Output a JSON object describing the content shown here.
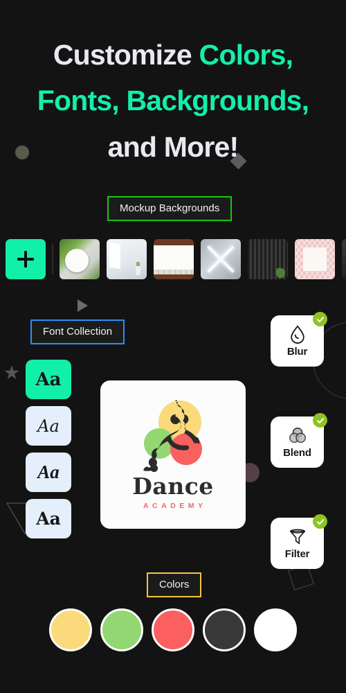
{
  "headline": {
    "line1_a": "Customize ",
    "line1_b": "Colors,",
    "line2": "Fonts, Backgrounds,",
    "line3_a": "and ",
    "line3_b": "More!"
  },
  "chips": {
    "mockup_backgrounds": "Mockup Backgrounds",
    "font_collection": "Font Collection",
    "colors": "Colors"
  },
  "thumbnails": {
    "add_label": "+",
    "items": [
      {
        "name": "plate-leaves-thumbnail",
        "style": "tb-plate"
      },
      {
        "name": "white-room-thumbnail",
        "style": "tb-room"
      },
      {
        "name": "wood-frame-thumbnail",
        "style": "tb-frame"
      },
      {
        "name": "light-panel-thumbnail",
        "style": "tb-lights"
      },
      {
        "name": "dark-slats-thumbnail",
        "style": "tb-slats"
      },
      {
        "name": "pink-palm-thumbnail",
        "style": "tb-palm"
      },
      {
        "name": "dark-wall-thumbnail",
        "style": "tb-dark"
      }
    ]
  },
  "font_cards": [
    {
      "label": "Aa",
      "style": "fc-slab",
      "selected": true
    },
    {
      "label": "Aa",
      "style": "fc-script",
      "selected": false
    },
    {
      "label": "Aa",
      "style": "fc-italic",
      "selected": false
    },
    {
      "label": "Aa",
      "style": "fc-bold",
      "selected": false
    }
  ],
  "features": [
    {
      "label": "Blur",
      "icon": "droplet-icon",
      "checked": true
    },
    {
      "label": "Blend",
      "icon": "three-circles-icon",
      "checked": true
    },
    {
      "label": "Filter",
      "icon": "funnel-icon",
      "checked": true
    }
  ],
  "logo": {
    "title": "Dance",
    "subtitle": "ACADEMY",
    "circle_yellow": "#fada7a",
    "circle_green": "#92d772",
    "circle_red": "#f8615e",
    "title_color": "#2e2e2e",
    "subtitle_color": "#f4666a"
  },
  "swatches": [
    {
      "name": "swatch-yellow",
      "color": "#fada7a"
    },
    {
      "name": "swatch-green",
      "color": "#92d772"
    },
    {
      "name": "swatch-red",
      "color": "#fb5f5f"
    },
    {
      "name": "swatch-dark",
      "color": "#383838"
    },
    {
      "name": "swatch-white",
      "color": "#ffffff"
    }
  ],
  "theme": {
    "background": "#131313",
    "accent_mint": "#12efa8",
    "selection_green": "#16c60c",
    "selection_blue": "#2b8ff5",
    "selection_yellow": "#f5c43f",
    "check_green": "#8dc423",
    "text_light": "#e9e9f2"
  }
}
